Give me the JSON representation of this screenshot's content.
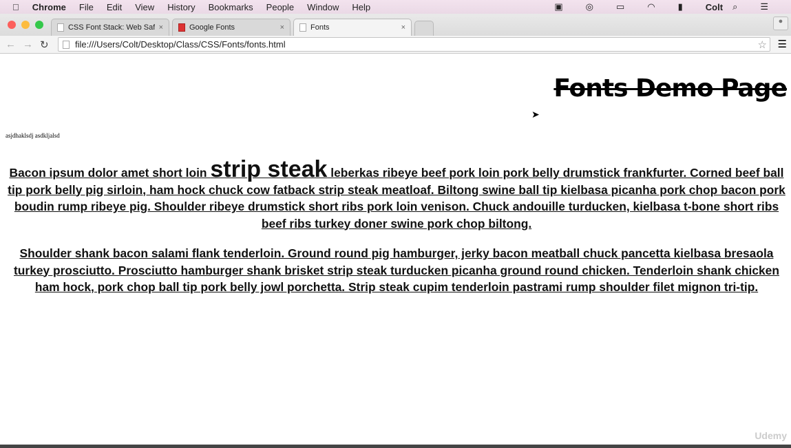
{
  "menubar": {
    "app": "Chrome",
    "items": [
      "File",
      "Edit",
      "View",
      "History",
      "Bookmarks",
      "People",
      "Window",
      "Help"
    ],
    "user": "Colt"
  },
  "tabs": [
    {
      "label": "CSS Font Stack: Web Safe",
      "close": "×"
    },
    {
      "label": "Google Fonts",
      "close": "×"
    },
    {
      "label": "Fonts",
      "close": "×",
      "active": true
    }
  ],
  "address": {
    "url": "file:///Users/Colt/Desktop/Class/CSS/Fonts/fonts.html"
  },
  "page": {
    "title": "Fonts Demo Page",
    "small_text": "asjdhaklsdj asdkljalsd",
    "p1_before": "Bacon ipsum dolor amet short loin ",
    "p1_big": "strip steak",
    "p1_after": " leberkas ribeye beef pork loin pork belly drumstick frankfurter. Corned beef ball tip pork belly pig sirloin, ham hock chuck cow fatback strip steak meatloaf. Biltong swine ball tip kielbasa picanha pork chop bacon pork boudin rump ribeye pig. Shoulder ribeye drumstick short ribs pork loin venison. Chuck andouille turducken, kielbasa t-bone short ribs beef ribs turkey doner swine pork chop biltong.",
    "p2": "Shoulder shank bacon salami flank tenderloin. Ground round pig hamburger, jerky bacon meatball chuck pancetta kielbasa bresaola turkey prosciutto. Prosciutto hamburger shank brisket strip steak turducken picanha ground round chicken. Tenderloin shank chicken ham hock, pork chop ball tip pork belly jowl porchetta. Strip steak cupim tenderloin pastrami rump shoulder filet mignon tri-tip."
  },
  "watermark": "Udemy"
}
